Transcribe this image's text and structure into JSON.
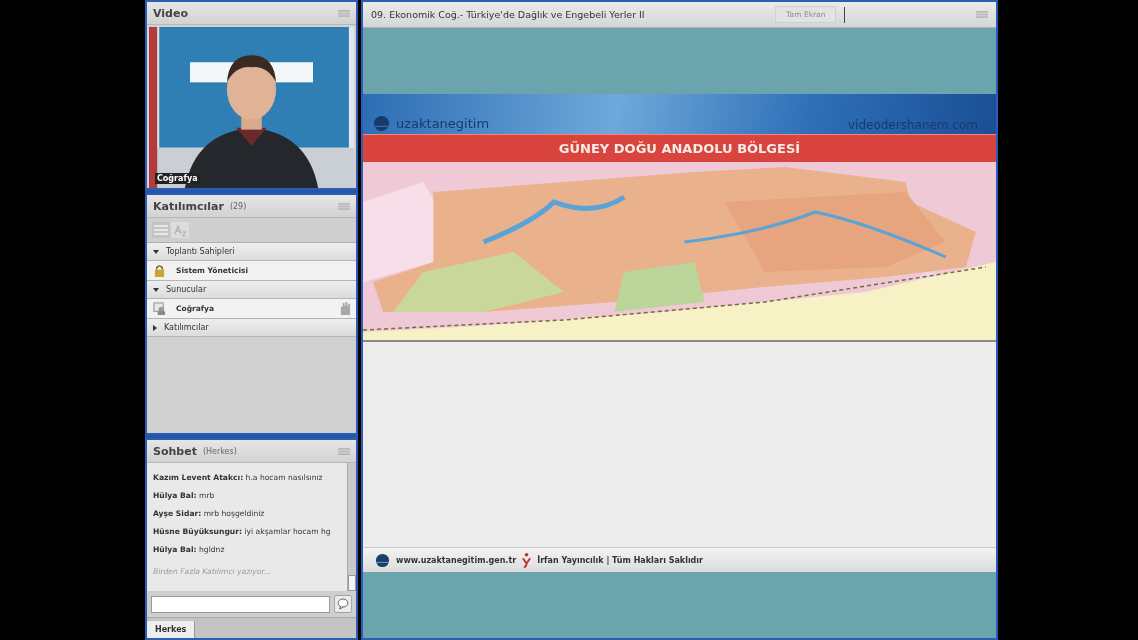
{
  "video_pod": {
    "title": "Video",
    "video": {
      "kind": "picture",
      "caption": "Coğrafya"
    }
  },
  "participants_pod": {
    "title": "Katılımcılar",
    "count": "(29)",
    "groups": [
      {
        "label": "Toplantı Sahipleri",
        "expanded": true,
        "children": [
          {
            "name": "Sistem Yöneticisi",
            "kind": "host"
          }
        ]
      },
      {
        "label": "Sunucular",
        "expanded": true,
        "children": [
          {
            "name": "Coğrafya",
            "kind": "presenter"
          }
        ]
      },
      {
        "label": "Katılımcılar",
        "expanded": false
      }
    ]
  },
  "chat_pod": {
    "title": "Sohbet",
    "scope": "(Herkes)",
    "messages": [
      {
        "author": "Kazım Levent Atakcı:",
        "text": "h.a hocam nasılsınız"
      },
      {
        "author": "Hülya Bal:",
        "text": "mrb"
      },
      {
        "author": "Ayşe Sidar:",
        "text": "mrb hoşgeldiniz"
      },
      {
        "author": "Hüsne Büyüksungur:",
        "text": "iyi akşamlar hocam hg"
      },
      {
        "author": "Hülya Bal:",
        "text": "hgldnz"
      }
    ],
    "typing_notice": "Birden Fazla Katılımcı yazıyor...",
    "tabs": [
      {
        "label": "Herkes",
        "selected": true
      }
    ]
  },
  "share_pod": {
    "title": "09. Ekonomik Coğ.- Türkiye'de Dağlık ve Engebeli Yerler II",
    "buttons": [
      {
        "label": "Tam Ekran",
        "disabled": true
      }
    ],
    "slide": {
      "brand": "uzaktanegitim",
      "site": "videodershanem.com",
      "heading": "GÜNEY DOĞU ANADOLU BÖLGESİ",
      "footer_url": "www.uzaktanegitim.gen.tr",
      "footer_text": "İrfan Yayıncılık | Tüm Hakları Saklıdır"
    }
  }
}
